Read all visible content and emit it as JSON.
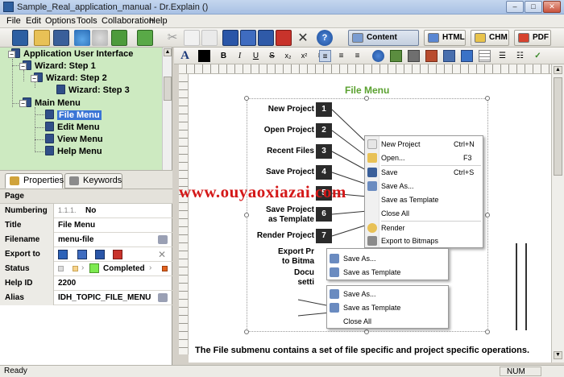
{
  "window": {
    "title": "Sample_Real_application_manual - Dr.Explain ()"
  },
  "menu": [
    "File",
    "Edit",
    "Options",
    "Tools",
    "Collaboration",
    "Help"
  ],
  "toolbar": {
    "content_editor": "Content Editor",
    "html": "HTML",
    "chm": "CHM",
    "pdf": "PDF"
  },
  "tree": {
    "items": [
      {
        "label": "Application User Interface"
      },
      {
        "label": "Wizard: Step 1"
      },
      {
        "label": "Wizard: Step 2"
      },
      {
        "label": "Wizard: Step 3"
      },
      {
        "label": "Main Menu"
      },
      {
        "label": "File Menu"
      },
      {
        "label": "Edit Menu"
      },
      {
        "label": "View Menu"
      },
      {
        "label": "Help Menu"
      }
    ]
  },
  "tabs": {
    "properties": "Properties",
    "keywords": "Keywords"
  },
  "properties": {
    "section": "Page",
    "rows": {
      "numbering": {
        "key": "Numbering",
        "prefix": "1.1.1.",
        "value": "No"
      },
      "title": {
        "key": "Title",
        "value": "File Menu"
      },
      "filename": {
        "key": "Filename",
        "value": "menu-file"
      },
      "export": {
        "key": "Export to"
      },
      "status": {
        "key": "Status",
        "value": "Completed",
        "color": "#7dea4f"
      },
      "helpid": {
        "key": "Help ID",
        "value": "2200"
      },
      "alias": {
        "key": "Alias",
        "value": "IDH_TOPIC_FILE_MENU"
      }
    }
  },
  "editor": {
    "heading": "File Menu",
    "heading_color": "#5aa12f",
    "callouts": [
      {
        "label": "New Project",
        "num": "1"
      },
      {
        "label": "Open Project",
        "num": "2"
      },
      {
        "label": "Recent Files",
        "num": "3"
      },
      {
        "label": "Save Project",
        "num": "4"
      },
      {
        "label": "Save Project\nAs",
        "num": "5"
      },
      {
        "label": "Save Project\nas Template",
        "num": "6"
      },
      {
        "label": "Render Project",
        "num": "7"
      },
      {
        "label": "Export Pr\nto Bitma",
        "num": ""
      },
      {
        "label": "Docu\nsetti",
        "num": ""
      }
    ],
    "menu_items": [
      {
        "label": "New Project",
        "shortcut": "Ctrl+N"
      },
      {
        "label": "Open...",
        "shortcut": "F3"
      },
      {
        "label": "Save",
        "shortcut": "Ctrl+S"
      },
      {
        "label": "Save As...",
        "shortcut": ""
      },
      {
        "label": "Save as Template",
        "shortcut": ""
      },
      {
        "label": "Close All",
        "shortcut": ""
      },
      {
        "label": "Render",
        "shortcut": ""
      },
      {
        "label": "Export to Bitmaps",
        "shortcut": ""
      }
    ],
    "sub_items_1": [
      "Save As...",
      "Save as Template"
    ],
    "sub_items_2": [
      "Save As...",
      "Save as Template",
      "Close All"
    ],
    "body_text": "The File submenu contains a set of file specific and project specific operations.",
    "watermark": "www.ouyaoxiazai.com"
  },
  "status": {
    "left": "Ready",
    "right": "NUM"
  }
}
